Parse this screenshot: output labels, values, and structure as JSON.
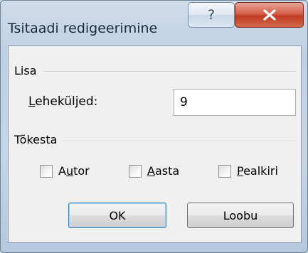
{
  "window": {
    "title": "Tsitaadi redigeerimine",
    "help_glyph": "?",
    "close_glyph": "x"
  },
  "add_group": {
    "label": "Lisa",
    "pages_label_first": "L",
    "pages_label_rest": "eheküljed:",
    "pages_value": "9"
  },
  "suppress_group": {
    "label": "Tõkesta",
    "options": [
      {
        "pre": "A",
        "accel": "u",
        "post": "tor",
        "checked": false
      },
      {
        "pre": "",
        "accel": "A",
        "post": "asta",
        "checked": false
      },
      {
        "pre": "",
        "accel": "P",
        "post": "ealkiri",
        "checked": false
      }
    ]
  },
  "buttons": {
    "ok": "OK",
    "cancel": "Loobu"
  }
}
